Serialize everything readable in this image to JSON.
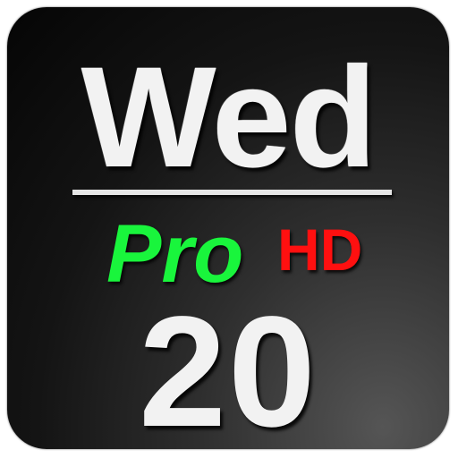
{
  "icon": {
    "day": "Wed",
    "pro_label": "Pro",
    "hd_label": "HD",
    "date": "20"
  },
  "colors": {
    "background": "#141414",
    "text": "#f2f2f2",
    "pro": "#19f53c",
    "hd": "#ff1010"
  }
}
